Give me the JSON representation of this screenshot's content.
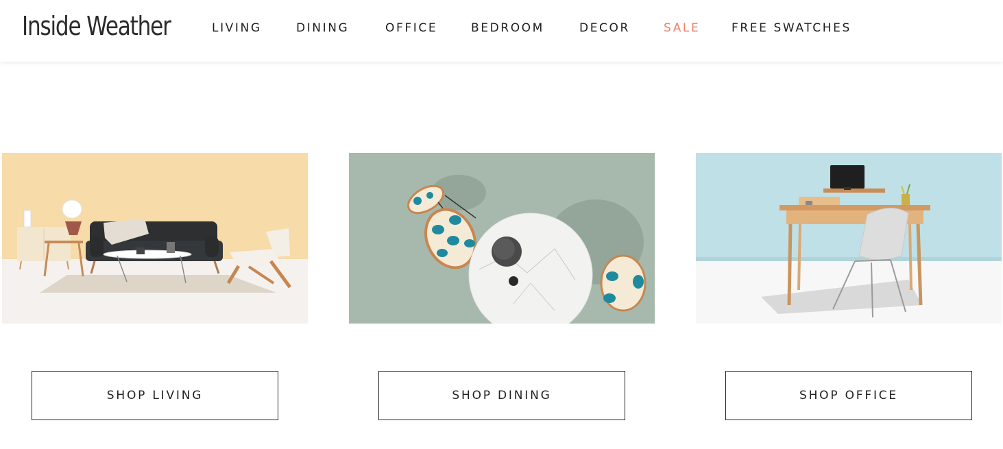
{
  "header": {
    "logo_text": "Inside Weather",
    "nav": [
      {
        "label": "LIVING"
      },
      {
        "label": "DINING"
      },
      {
        "label": "OFFICE"
      },
      {
        "label": "BEDROOM"
      },
      {
        "label": "DECOR"
      },
      {
        "label": "SALE"
      },
      {
        "label": "FREE SWATCHES"
      }
    ],
    "sale_color": "#e8836a"
  },
  "categories": [
    {
      "image": "living-room-sofa-scene",
      "button_label": "SHOP LIVING",
      "bg_color": "#f7dba8"
    },
    {
      "image": "dining-table-topdown-scene",
      "button_label": "SHOP DINING",
      "bg_color": "#a7b9ad"
    },
    {
      "image": "office-desk-scene",
      "button_label": "SHOP OFFICE",
      "bg_color": "#bfe0e6"
    }
  ]
}
